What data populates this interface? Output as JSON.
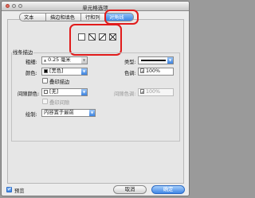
{
  "window": {
    "title": "单元格选项"
  },
  "tabs": [
    {
      "label": "文本"
    },
    {
      "label": "描边和填色"
    },
    {
      "label": "行和列"
    },
    {
      "label": "对角线"
    }
  ],
  "diagonal_icons": [
    "no-diagonal-icon",
    "diagonal-down-icon",
    "diagonal-up-icon",
    "diagonal-cross-icon"
  ],
  "stroke": {
    "group_label": "线条描边",
    "weight_label": "粗细:",
    "weight_value": "0.25 毫米",
    "type_label": "类型:",
    "color_label": "颜色:",
    "color_value": "[黑色]",
    "tint_label": "色调:",
    "tint_value": "100%",
    "overprint_stroke_label": "叠印描边",
    "gap_color_label": "间隙颜色:",
    "gap_color_value": "[无]",
    "gap_tint_label": "间隙色调:",
    "gap_tint_value": "100%",
    "overprint_gap_label": "叠印间隙",
    "draw_label": "绘制:",
    "draw_value": "内容置于最前"
  },
  "footer": {
    "preview_label": "预览",
    "preview_checked": true,
    "cancel_label": "取消",
    "ok_label": "确定"
  },
  "colors": {
    "accent": "#3d86e4",
    "annotation": "#e11b1b"
  }
}
